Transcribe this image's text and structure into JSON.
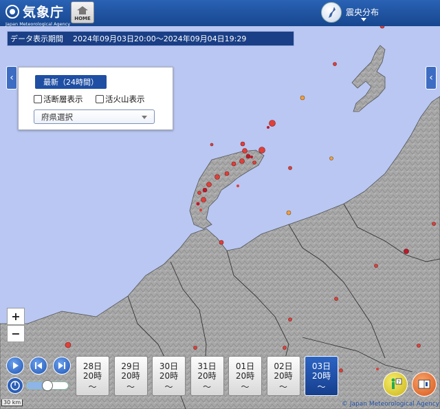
{
  "header": {
    "logo_title": "気象庁",
    "logo_subtitle": "Japan Meteorological Agency",
    "home_label": "HOME",
    "mode_label": "震央分布"
  },
  "period": {
    "label": "データ表示期間",
    "range": "2024年09月03日20:00〜2024年09月04日19:29"
  },
  "filter_panel": {
    "latest_button": "最新（24時間）",
    "active_fault_label": "活断層表示",
    "active_volcano_label": "活火山表示",
    "prefecture_select": "府県選択"
  },
  "zoom": {
    "in": "+",
    "out": "−"
  },
  "timeline": {
    "days": [
      {
        "date": "28日",
        "time": "20時",
        "active": false
      },
      {
        "date": "29日",
        "time": "20時",
        "active": false
      },
      {
        "date": "30日",
        "time": "20時",
        "active": false
      },
      {
        "date": "31日",
        "time": "20時",
        "active": false
      },
      {
        "date": "01日",
        "time": "20時",
        "active": false
      },
      {
        "date": "02日",
        "time": "20時",
        "active": false
      },
      {
        "date": "03日",
        "time": "20時",
        "active": true
      }
    ],
    "wave_glyph": "〜"
  },
  "scale_label": "30 km",
  "credit": "© Japan Meteorological Agency",
  "colors": {
    "header": "#1f4fa3",
    "sea": "#b9c7f2",
    "land": "#a9a9a9",
    "quake_marker": "#e0403a",
    "quake_marker_deep": "#c0182a",
    "quake_marker_shallow": "#f0a040"
  },
  "icons": [
    "home-icon",
    "globe-icon",
    "chevron-left-icon",
    "play-icon",
    "skip-back-icon",
    "skip-forward-icon",
    "speed-icon",
    "help-icon",
    "book-icon"
  ]
}
